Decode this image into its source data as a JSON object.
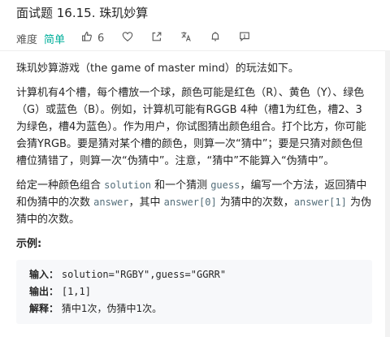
{
  "header": {
    "title": "面试题 16.15. 珠玑妙算",
    "difficulty_label": "难度",
    "difficulty_value": "简单",
    "like_count": "6"
  },
  "content": {
    "p1": "珠玑妙算游戏（the game of master mind）的玩法如下。",
    "p2": "计算机有4个槽，每个槽放一个球，颜色可能是红色（R）、黄色（Y）、绿色（G）或蓝色（B）。例如，计算机可能有RGGB 4种（槽1为红色，槽2、3为绿色，槽4为蓝色）。作为用户，你试图猜出颜色组合。打个比方，你可能会猜YRGB。要是猜对某个槽的颜色，则算一次“猜中”；要是只猜对颜色但槽位猜错了，则算一次“伪猜中”。注意，“猜中”不能算入“伪猜中”。",
    "p3_a": "给定一种颜色组合 ",
    "p3_code1": "solution",
    "p3_b": " 和一个猜测 ",
    "p3_code2": "guess",
    "p3_c": "，编写一个方法，返回猜中和伪猜中的次数 ",
    "p3_code3": "answer",
    "p3_d": "，其中 ",
    "p3_code4": "answer[0]",
    "p3_e": " 为猜中的次数，",
    "p3_code5": "answer[1]",
    "p3_f": " 为伪猜中的次数。",
    "example_label": "示例:",
    "example": {
      "input_label": "输入：",
      "input_value": "solution=\"RGBY\",guess=\"GGRR\"",
      "output_label": "输出：",
      "output_value": "[1,1]",
      "explain_label": "解释：",
      "explain_value": "猜中1次，伪猜中1次。"
    }
  },
  "icons": {
    "like": "thumbs-up-icon",
    "favorite": "heart-icon",
    "share": "share-icon",
    "translate": "translate-icon",
    "notify": "bell-icon",
    "feedback": "feedback-icon"
  },
  "colors": {
    "easy": "#00af9b",
    "code": "#546e7a",
    "example_bg": "#f7f8fa"
  }
}
